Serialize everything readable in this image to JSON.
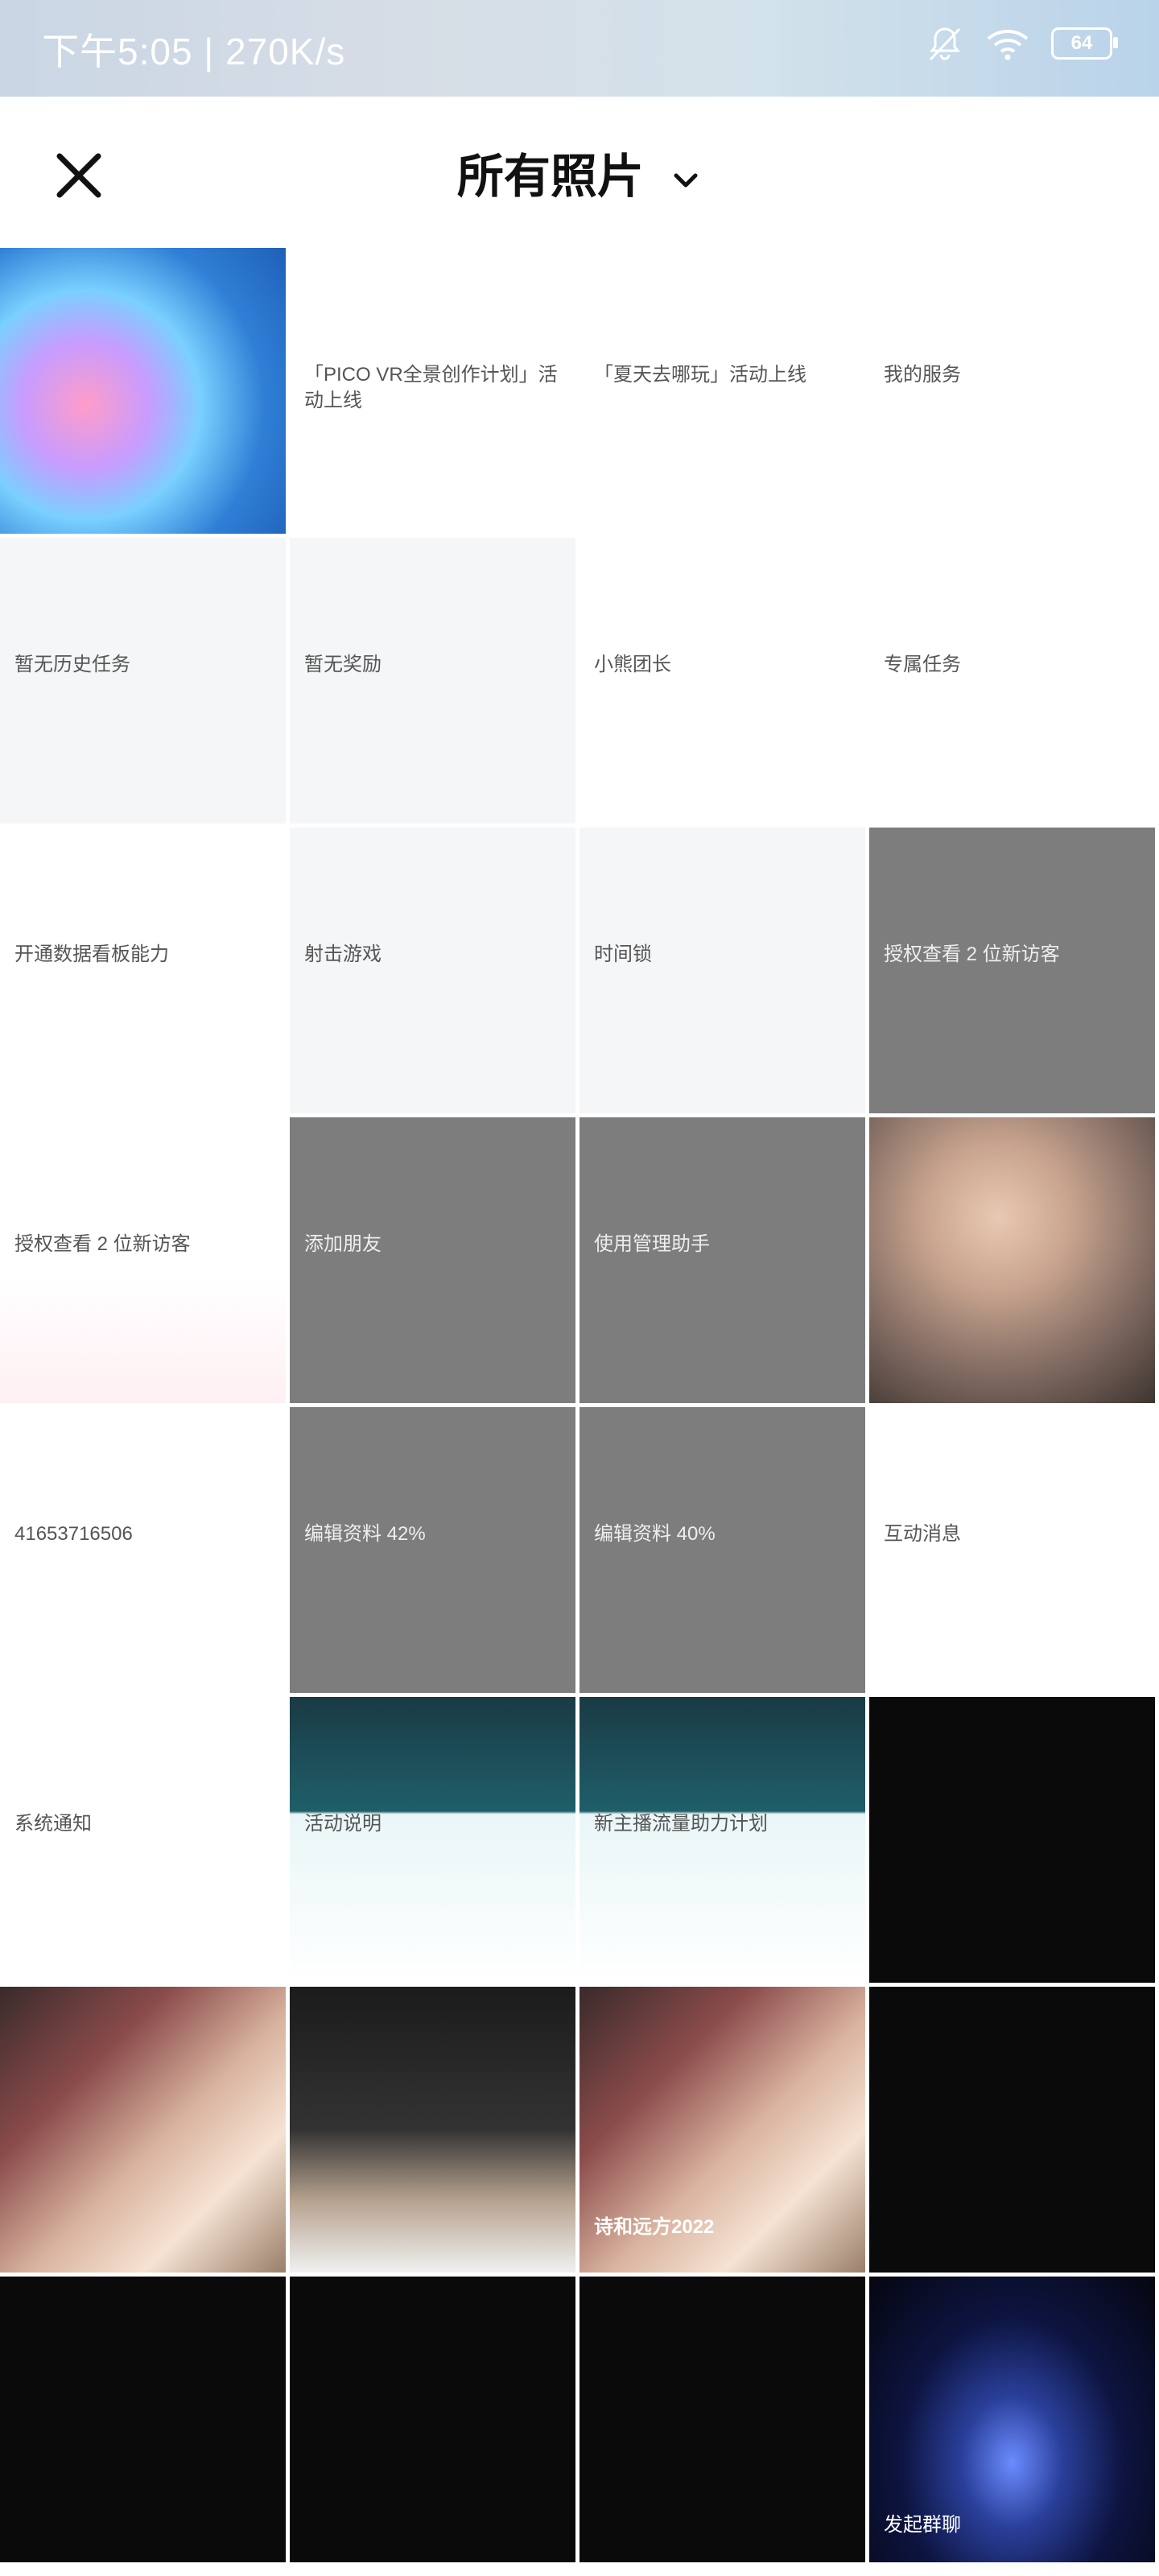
{
  "status_bar": {
    "time_text": "下午5:05 | 270K/s",
    "battery": "64"
  },
  "header": {
    "album_title": "所有照片"
  },
  "photos": [
    {
      "text": ""
    },
    {
      "text": "「PICO VR全景创作计划」活动上线"
    },
    {
      "text": "「夏天去哪玩」活动上线"
    },
    {
      "text": "我的服务"
    },
    {
      "text": "暂无历史任务"
    },
    {
      "text": "暂无奖励"
    },
    {
      "text": "小熊团长"
    },
    {
      "text": "专属任务"
    },
    {
      "text": "开通数据看板能力"
    },
    {
      "text": "射击游戏"
    },
    {
      "text": "时间锁"
    },
    {
      "text": "授权查看 2 位新访客"
    },
    {
      "text": "授权查看 2 位新访客"
    },
    {
      "text": "添加朋友"
    },
    {
      "text": "使用管理助手"
    },
    {
      "text": ""
    },
    {
      "text": "41653716506"
    },
    {
      "text": "编辑资料 42%"
    },
    {
      "text": "编辑资料 40%"
    },
    {
      "text": "互动消息"
    },
    {
      "text": "系统通知"
    },
    {
      "text": "活动说明"
    },
    {
      "text": "新主播流量助力计划"
    },
    {
      "text": ""
    },
    {
      "text": ""
    },
    {
      "text": ""
    },
    {
      "text": "诗和远方2022"
    },
    {
      "text": ""
    },
    {
      "text": ""
    },
    {
      "text": ""
    },
    {
      "text": ""
    },
    {
      "text": "发起群聊"
    }
  ]
}
